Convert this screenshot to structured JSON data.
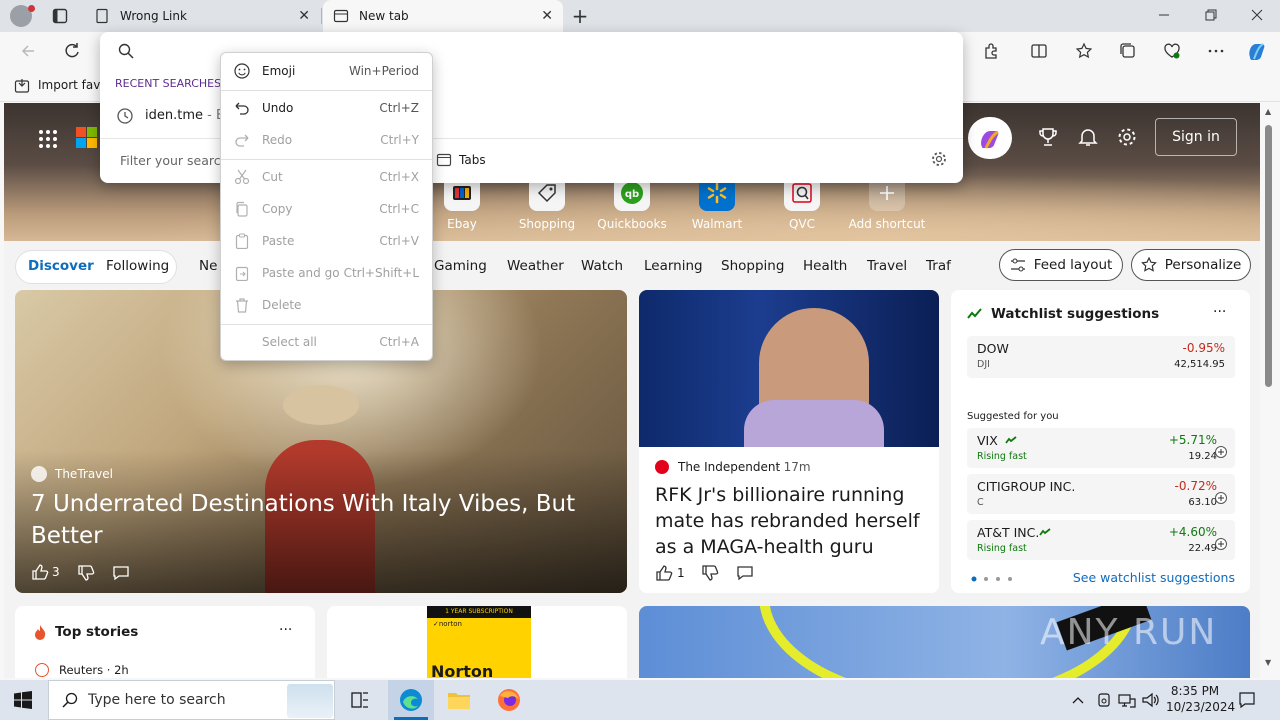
{
  "tabs": [
    {
      "title": "Wrong Link",
      "close": "✕"
    },
    {
      "title": "New tab",
      "close": "✕"
    }
  ],
  "favorites": {
    "import_label": "Import favo"
  },
  "omnibox": {
    "recent_header": "RECENT SEARCHES",
    "recent_item": "iden.tme",
    "recent_suffix": "- E",
    "filter_placeholder": "Filter your search",
    "tabs_label": "Tabs"
  },
  "context_menu": {
    "items": [
      {
        "label": "Emoji",
        "key": "Win+Period",
        "enabled": true
      },
      {
        "label": "Undo",
        "key": "Ctrl+Z",
        "enabled": true
      },
      {
        "label": "Redo",
        "key": "Ctrl+Y",
        "enabled": false
      },
      {
        "label": "Cut",
        "key": "Ctrl+X",
        "enabled": false
      },
      {
        "label": "Copy",
        "key": "Ctrl+C",
        "enabled": false
      },
      {
        "label": "Paste",
        "key": "Ctrl+V",
        "enabled": false
      },
      {
        "label": "Paste and go",
        "key": "Ctrl+Shift+L",
        "enabled": false
      },
      {
        "label": "Delete",
        "key": "",
        "enabled": false
      },
      {
        "label": "Select all",
        "key": "Ctrl+A",
        "enabled": false
      }
    ]
  },
  "header": {
    "sign_in": "Sign in"
  },
  "shortcuts": [
    {
      "label": "Ebay"
    },
    {
      "label": "Shopping"
    },
    {
      "label": "Quickbooks"
    },
    {
      "label": "Walmart"
    },
    {
      "label": "QVC"
    },
    {
      "label": "Add shortcut"
    }
  ],
  "nav": {
    "items": [
      "Discover",
      "Following",
      "Ne",
      "Gaming",
      "Weather",
      "Watch",
      "Learning",
      "Shopping",
      "Health",
      "Travel",
      "Traf"
    ],
    "feed_layout": "Feed layout",
    "personalize": "Personalize"
  },
  "main_story": {
    "source": "TheTravel",
    "title": "7 Underrated Destinations With Italy Vibes, But Better",
    "likes": "3"
  },
  "story2": {
    "source": "The Independent",
    "time": "· 17m",
    "title": "RFK Jr's billionaire running mate has rebranded herself as a MAGA-health guru",
    "likes": "1"
  },
  "watchlist": {
    "title": "Watchlist suggestions",
    "more": "···",
    "dow": {
      "name": "DOW",
      "sub": "DJI",
      "change": "-0.95%",
      "value": "42,514.95"
    },
    "suggested_label": "Suggested for you",
    "items": [
      {
        "name": "VIX",
        "sub": "Rising fast",
        "change": "+5.71%",
        "value": "19.24"
      },
      {
        "name": "CITIGROUP INC.",
        "sub": "C",
        "change": "-0.72%",
        "value": "63.10"
      },
      {
        "name": "AT&T INC.",
        "sub": "Rising fast",
        "change": "+4.60%",
        "value": "22.49"
      }
    ],
    "see_more": "See watchlist suggestions"
  },
  "top_stories": {
    "title": "Top stories",
    "more": "···",
    "source": "Reuters · 2h"
  },
  "ad": {
    "banner": "1 YEAR SUBSCRIPTION",
    "brand": "Norton"
  },
  "taskbar": {
    "search_placeholder": "Type here to search",
    "time": "8:35 PM",
    "date": "10/23/2024"
  },
  "watermark": "ANY RUN",
  "colors": {
    "accent": "#0f6cbd",
    "negative": "#c42b1c",
    "positive": "#0e7a0d"
  }
}
